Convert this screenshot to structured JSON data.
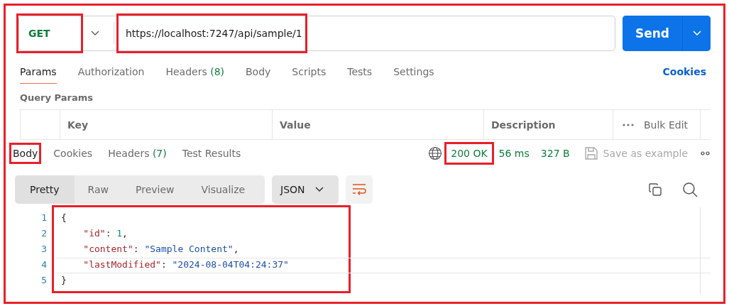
{
  "request": {
    "method": "GET",
    "method_highlighted": true,
    "url": "https://localhost:7247/api/sample/1",
    "url_highlighted": true,
    "send_label": "Send"
  },
  "request_tabs": [
    {
      "label": "Params",
      "selected": true
    },
    {
      "label": "Authorization",
      "selected": false
    },
    {
      "label": "Headers",
      "count": "(8)",
      "selected": false
    },
    {
      "label": "Body",
      "selected": false
    },
    {
      "label": "Scripts",
      "selected": false
    },
    {
      "label": "Tests",
      "selected": false
    },
    {
      "label": "Settings",
      "selected": false
    }
  ],
  "cookies_link": "Cookies",
  "query_params": {
    "title": "Query Params",
    "columns": [
      "Key",
      "Value",
      "Description"
    ],
    "bulk_edit": "Bulk Edit"
  },
  "response_tabs": [
    {
      "label": "Body",
      "selected": true,
      "highlighted": true
    },
    {
      "label": "Cookies",
      "selected": false,
      "highlighted": false
    },
    {
      "label": "Headers",
      "count": "(7)",
      "selected": false,
      "highlighted": false
    },
    {
      "label": "Test Results",
      "selected": false,
      "highlighted": false
    }
  ],
  "response_meta": {
    "status": "200 OK",
    "status_highlighted": true,
    "time": "56 ms",
    "size": "327 B",
    "save_label": "Save as example"
  },
  "view_modes": [
    {
      "label": "Pretty",
      "selected": true
    },
    {
      "label": "Raw",
      "selected": false
    },
    {
      "label": "Preview",
      "selected": false
    },
    {
      "label": "Visualize",
      "selected": false
    }
  ],
  "format": "JSON",
  "code": {
    "highlighted": true,
    "lines": [
      {
        "number": "1",
        "text": "{"
      },
      {
        "number": "2",
        "text": "    \"id\": 1,"
      },
      {
        "number": "3",
        "text": "    \"content\": \"Sample Content\","
      },
      {
        "number": "4",
        "text": "    \"lastModified\": \"2024-08-04T04:24:37\"",
        "current": true
      },
      {
        "number": "5",
        "text": "}"
      }
    ]
  }
}
